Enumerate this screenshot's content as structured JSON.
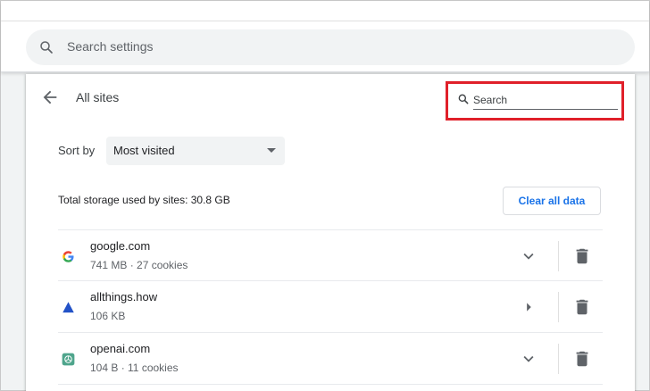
{
  "header": {
    "search_placeholder": "Search settings",
    "search_icon": "search-icon"
  },
  "page": {
    "title": "All sites",
    "back_icon": "arrow-back-icon",
    "site_search_placeholder": "Search"
  },
  "sort": {
    "label": "Sort by",
    "selected": "Most visited"
  },
  "storage": {
    "text": "Total storage used by sites: 30.8 GB",
    "clear_label": "Clear all data"
  },
  "sites": [
    {
      "name": "google.com",
      "meta": "741 MB · 27 cookies",
      "favicon": "google-favicon-icon",
      "expander": "chevron-down-icon"
    },
    {
      "name": "allthings.how",
      "meta": "106 KB",
      "favicon": "allthings-favicon-icon",
      "expander": "caret-right-icon"
    },
    {
      "name": "openai.com",
      "meta": "104 B · 11 cookies",
      "favicon": "openai-favicon-icon",
      "expander": "chevron-down-icon"
    }
  ],
  "colors": {
    "accent": "#1a73e8",
    "highlight": "#e0202a",
    "background": "#f1f3f4"
  }
}
